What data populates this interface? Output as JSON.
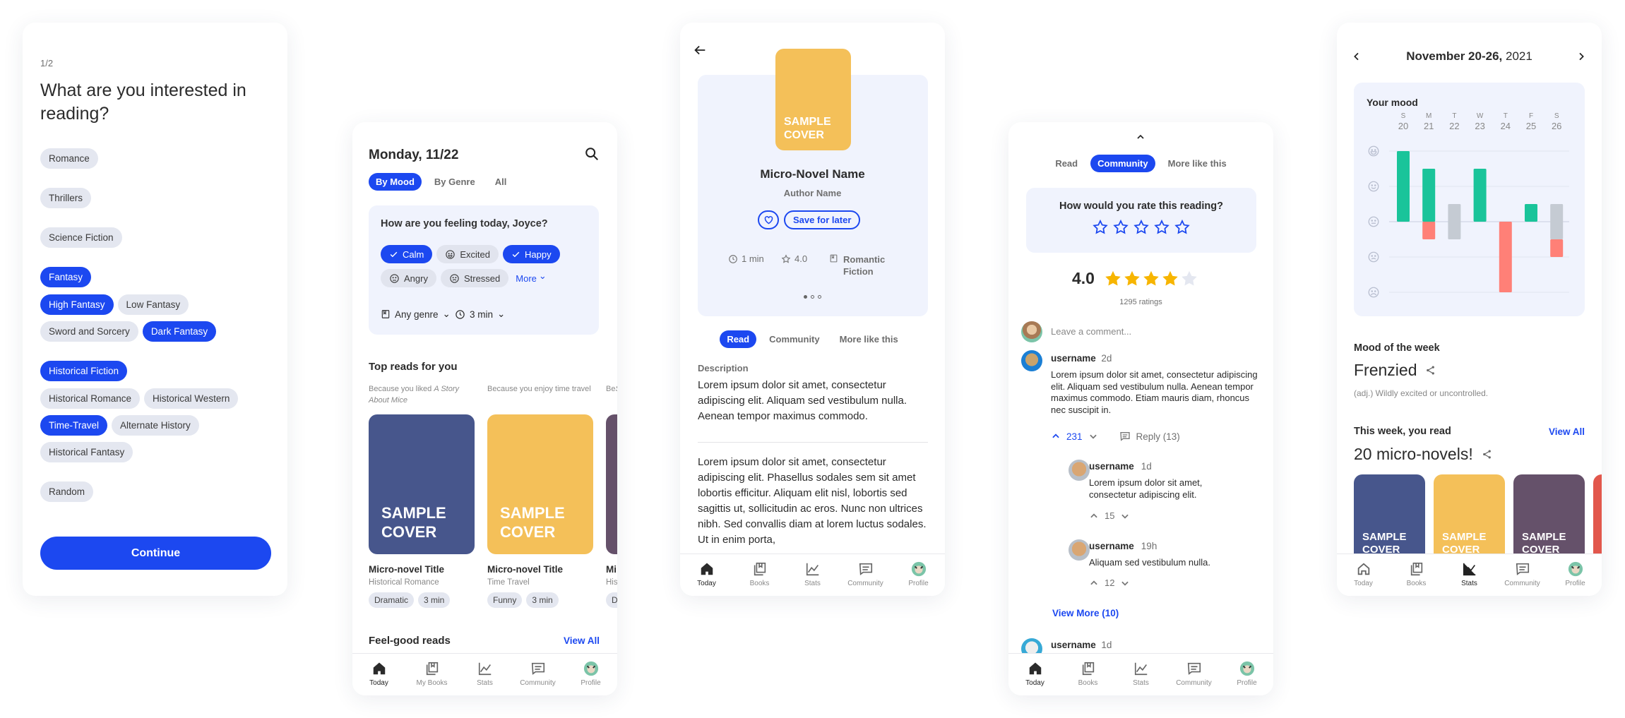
{
  "colors": {
    "accent": "#1c48f0",
    "chip": "#e4e7f0",
    "panel": "#f0f3fd",
    "positive": "#1ac49a",
    "neutral": "#c5cbd3",
    "negative": "#ff8077",
    "star": "#f7b500"
  },
  "onboarding": {
    "step": "1/2",
    "title": "What are you interested in reading?",
    "groups": [
      {
        "parent": {
          "label": "Romance",
          "selected": false
        },
        "children": []
      },
      {
        "parent": {
          "label": "Thrillers",
          "selected": false
        },
        "children": []
      },
      {
        "parent": {
          "label": "Science Fiction",
          "selected": false
        },
        "children": []
      },
      {
        "parent": {
          "label": "Fantasy",
          "selected": true
        },
        "children": [
          {
            "label": "High Fantasy",
            "selected": true
          },
          {
            "label": "Low Fantasy",
            "selected": false
          },
          {
            "label": "Sword and Sorcery",
            "selected": false
          },
          {
            "label": "Dark Fantasy",
            "selected": true
          }
        ]
      },
      {
        "parent": {
          "label": "Historical Fiction",
          "selected": true
        },
        "children": [
          {
            "label": "Historical Romance",
            "selected": false
          },
          {
            "label": "Historical Western",
            "selected": false
          },
          {
            "label": "Time-Travel",
            "selected": true
          },
          {
            "label": "Alternate History",
            "selected": false
          },
          {
            "label": "Historical Fantasy",
            "selected": false
          }
        ]
      },
      {
        "parent": {
          "label": "Random",
          "selected": false
        },
        "children": []
      }
    ],
    "continue_label": "Continue"
  },
  "today": {
    "date": "Monday, 11/22",
    "tabs": [
      {
        "label": "By Mood",
        "active": true
      },
      {
        "label": "By Genre",
        "active": false
      },
      {
        "label": "All",
        "active": false
      }
    ],
    "mood_question": "How are you feeling today, Joyce?",
    "moods": [
      {
        "label": "Calm",
        "selected": true,
        "icon": "check-icon"
      },
      {
        "label": "Excited",
        "selected": false,
        "icon": "face-excited-icon"
      },
      {
        "label": "Happy",
        "selected": true,
        "icon": "check-icon"
      },
      {
        "label": "Angry",
        "selected": false,
        "icon": "face-angry-icon"
      },
      {
        "label": "Stressed",
        "selected": false,
        "icon": "face-stressed-icon"
      }
    ],
    "more_label": "More",
    "genre_filter": "Any genre",
    "time_filter": "3 min",
    "top_reads_title": "Top reads for you",
    "books": [
      {
        "reason": "Because you liked ",
        "reason_italic": "A Story About Mice",
        "cover_text": "SAMPLE COVER",
        "cover_color": "#47568c",
        "title": "Micro-novel Title",
        "genre": "Historical Romance",
        "tags": [
          "Dramatic",
          "3 min"
        ]
      },
      {
        "reason": "Because you enjoy time travel",
        "reason_italic": "",
        "cover_text": "SAMPLE COVER",
        "cover_color": "#f4c059",
        "title": "Micro-novel Title",
        "genre": "Time Travel",
        "tags": [
          "Funny",
          "3 min"
        ]
      },
      {
        "reason": "Be",
        "reason_italic": "Sto",
        "cover_text": "",
        "cover_color": "#65516a",
        "title": "Mi",
        "genre": "His",
        "tags": [
          "D"
        ]
      }
    ],
    "feel_good_title": "Feel-good reads",
    "view_all": "View All",
    "nav": [
      {
        "label": "Today",
        "icon": "home-icon",
        "active": true
      },
      {
        "label": "My Books",
        "icon": "books-icon",
        "active": false
      },
      {
        "label": "Stats",
        "icon": "stats-icon",
        "active": false
      },
      {
        "label": "Community",
        "icon": "community-icon",
        "active": false
      },
      {
        "label": "Profile",
        "icon": "profile-avatar",
        "active": false
      }
    ]
  },
  "detail": {
    "cover_text": "SAMPLE COVER",
    "cover_color": "#f4c059",
    "title": "Micro-Novel Name",
    "author": "Author Name",
    "save_label": "Save for later",
    "meta": {
      "duration": "1 min",
      "rating": "4.0",
      "genre": "Romantic Fiction"
    },
    "carousel": {
      "pages": 3,
      "current": 1
    },
    "tabs": [
      {
        "label": "Read",
        "active": true
      },
      {
        "label": "Community",
        "active": false
      },
      {
        "label": "More like this",
        "active": false
      }
    ],
    "description_label": "Description",
    "description": "Lorem ipsum dolor sit amet, consectetur adipiscing elit. Aliquam sed vestibulum nulla. Aenean tempor maximus commodo.",
    "body": "Lorem ipsum dolor sit amet, consectetur adipiscing elit. Phasellus sodales sem sit amet lobortis efficitur. Aliquam elit nisl, lobortis sed sagittis ut, sollicitudin ac eros. Nunc non ultrices nibh. Sed convallis diam at lorem luctus sodales. Ut in enim porta,",
    "nav": [
      {
        "label": "Today",
        "icon": "home-icon",
        "active": true
      },
      {
        "label": "Books",
        "icon": "books-icon",
        "active": false
      },
      {
        "label": "Stats",
        "icon": "stats-icon",
        "active": false
      },
      {
        "label": "Community",
        "icon": "community-icon",
        "active": false
      },
      {
        "label": "Profile",
        "icon": "profile-avatar",
        "active": false
      }
    ]
  },
  "community": {
    "tabs": [
      {
        "label": "Read",
        "active": false
      },
      {
        "label": "Community",
        "active": true
      },
      {
        "label": "More like this",
        "active": false
      }
    ],
    "rate_question": "How would you rate this reading?",
    "rating": "4.0",
    "rating_stars": 4,
    "ratings_count": "1295 ratings",
    "comment_placeholder": "Leave a comment...",
    "comment": {
      "username": "username",
      "time": "2d",
      "text": "Lorem ipsum dolor sit amet, consectetur adipiscing elit. Aliquam sed vestibulum nulla. Aenean tempor maximus commodo. Etiam mauris diam, rhoncus nec suscipit in.",
      "votes": "231",
      "reply_label": "Reply (13)"
    },
    "replies": [
      {
        "username": "username",
        "time": "1d",
        "text": "Lorem ipsum dolor sit amet, consectetur adipiscing elit.",
        "votes": "15"
      },
      {
        "username": "username",
        "time": "19h",
        "text": "Aliquam sed vestibulum nulla.",
        "votes": "12"
      }
    ],
    "view_more": "View More (10)",
    "next_comment": {
      "username": "username",
      "time": "1d"
    },
    "nav": [
      {
        "label": "Today",
        "icon": "home-icon",
        "active": true
      },
      {
        "label": "Books",
        "icon": "books-icon",
        "active": false
      },
      {
        "label": "Stats",
        "icon": "stats-icon",
        "active": false
      },
      {
        "label": "Community",
        "icon": "community-icon",
        "active": false
      },
      {
        "label": "Profile",
        "icon": "profile-avatar",
        "active": false
      }
    ]
  },
  "stats": {
    "range_bold": "November 20-26,",
    "range_year": " 2021",
    "mood_of_week_label": "Mood of the week",
    "mood_word": "Frenzied",
    "mood_definition": "(adj.) Wildly excited or uncontrolled.",
    "read_label": "This week, you read",
    "view_all": "View All",
    "read_count": "20 micro-novels!",
    "covers": [
      {
        "text": "SAMPLE COVER",
        "color": "#47568c"
      },
      {
        "text": "SAMPLE COVER",
        "color": "#f4c059"
      },
      {
        "text": "SAMPLE COVER",
        "color": "#65516a"
      },
      {
        "text": "",
        "color": "#e2574c"
      }
    ],
    "nav": [
      {
        "label": "Today",
        "icon": "home-icon",
        "active": false
      },
      {
        "label": "Books",
        "icon": "books-icon",
        "active": false
      },
      {
        "label": "Stats",
        "icon": "stats-icon",
        "active": true
      },
      {
        "label": "Community",
        "icon": "community-icon",
        "active": false
      },
      {
        "label": "Profile",
        "icon": "profile-avatar",
        "active": false
      }
    ]
  },
  "chart_data": {
    "type": "bar",
    "title": "Your mood",
    "categories": [
      "S",
      "M",
      "T",
      "W",
      "T",
      "F",
      "S"
    ],
    "dates": [
      "20",
      "21",
      "22",
      "23",
      "24",
      "25",
      "26"
    ],
    "y_tick_icons": [
      "face-very-happy-icon",
      "face-happy-icon",
      "face-neutral-icon",
      "face-sad-icon",
      "face-very-sad-icon"
    ],
    "ylim": [
      -2,
      2
    ],
    "grid": true,
    "bars": [
      [
        {
          "from": 0,
          "to": 2,
          "tone": "positive"
        }
      ],
      [
        {
          "from": 0,
          "to": 1.5,
          "tone": "positive"
        },
        {
          "from": -0.5,
          "to": 0,
          "tone": "negative"
        }
      ],
      [
        {
          "from": -0.5,
          "to": 0.5,
          "tone": "neutral"
        }
      ],
      [
        {
          "from": 0,
          "to": 1.5,
          "tone": "positive"
        }
      ],
      [
        {
          "from": -2,
          "to": 0,
          "tone": "negative"
        }
      ],
      [
        {
          "from": 0,
          "to": 0.5,
          "tone": "positive"
        }
      ],
      [
        {
          "from": -0.5,
          "to": 0.5,
          "tone": "neutral"
        },
        {
          "from": -1,
          "to": -0.5,
          "tone": "negative"
        }
      ]
    ]
  }
}
